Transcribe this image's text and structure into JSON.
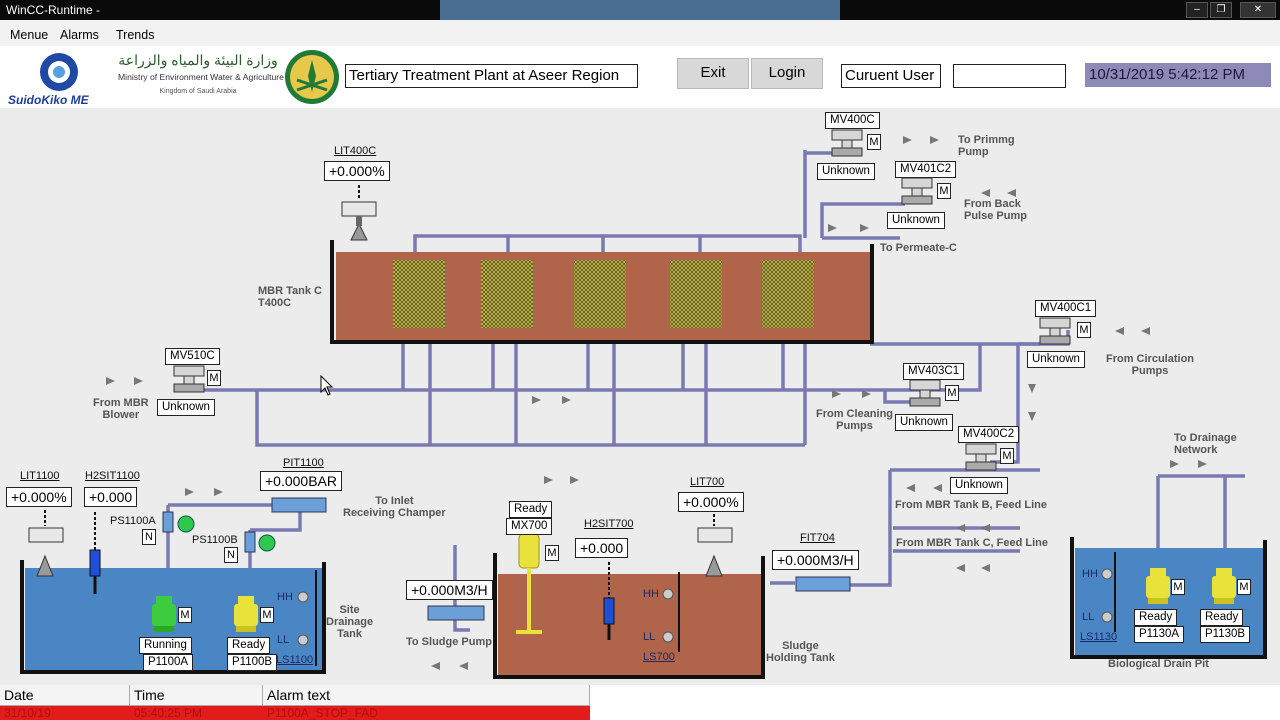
{
  "window": {
    "title": "WinCC-Runtime -"
  },
  "menu": {
    "items": [
      "Menue",
      "Alarms",
      "Trends"
    ]
  },
  "header": {
    "logo_left_text": "SuidoKiko ME",
    "ministry_arabic": "وزارة البيئة والمياه والزراعة",
    "ministry_english": "Ministry of Environment Water & Agriculture",
    "kingdom_line": "Kingdom of Saudi Arabia",
    "plant_title": "Tertiary Treatment Plant at Aseer Region",
    "exit_label": "Exit",
    "login_label": "Login",
    "current_user_label": "Curuent User",
    "current_user_value": "",
    "datetime": "10/31/2019 5:42:12 PM"
  },
  "process": {
    "lit400c": {
      "tag": "LIT400C",
      "value": "+0.000%"
    },
    "mbr_tank": {
      "line1": "MBR Tank C",
      "line2": "T400C"
    },
    "mv400c": {
      "tag": "MV400C",
      "mode": "M",
      "status": "Unknown"
    },
    "mv401c2": {
      "tag": "MV401C2",
      "mode": "M",
      "status": "Unknown"
    },
    "mv400c1": {
      "tag": "MV400C1",
      "mode": "M",
      "status": "Unknown"
    },
    "mv403c1": {
      "tag": "MV403C1",
      "mode": "M",
      "status": "Unknown"
    },
    "mv400c2": {
      "tag": "MV400C2",
      "mode": "M",
      "status": "Unknown"
    },
    "mv510c": {
      "tag": "MV510C",
      "mode": "M",
      "status": "Unknown"
    },
    "lbl_priming": {
      "line1": "To Primmg",
      "line2": "Pump"
    },
    "lbl_backpulse": {
      "line1": "From Back",
      "line2": "Pulse Pump"
    },
    "lbl_permeate": "To Permeate-C",
    "lbl_circulation": {
      "line1": "From Circulation",
      "line2": "Pumps"
    },
    "lbl_cleaning": {
      "line1": "From Cleaning",
      "line2": "Pumps"
    },
    "lbl_mbr_blower": {
      "line1": "From MBR",
      "line2": "Blower"
    },
    "lbl_feed_b": "From MBR Tank B, Feed Line",
    "lbl_feed_c": "From MBR Tank C, Feed Line",
    "lbl_drainage_network": {
      "line1": "To Drainage",
      "line2": "Network"
    },
    "lit1100": {
      "tag": "LIT1100",
      "value": "+0.000%"
    },
    "h2sit1100": {
      "tag": "H2SIT1100",
      "value": "+0.000"
    },
    "pit1100": {
      "tag": "PIT1100",
      "value": "+0.000BAR"
    },
    "lbl_inlet": {
      "line1": "To Inlet",
      "line2": "Receiving Champer"
    },
    "ps1100a": {
      "tag": "PS1100A",
      "mode": "N"
    },
    "ps1100b": {
      "tag": "PS1100B",
      "mode": "N"
    },
    "p1100a": {
      "tag": "P1100A",
      "status": "Running",
      "mode": "M"
    },
    "p1100b": {
      "tag": "P1100B",
      "status": "Ready",
      "mode": "M"
    },
    "site_tank": {
      "line1": "Site",
      "line2": "Drainage",
      "line3": "Tank",
      "hh": "HH",
      "ll": "LL",
      "ls": "LS1100"
    },
    "mx700": {
      "tag": "MX700",
      "status": "Ready",
      "mode": "M"
    },
    "h2sit700": {
      "tag": "H2SIT700",
      "value": "+0.000"
    },
    "lit700": {
      "tag": "LIT700",
      "value": "+0.000%"
    },
    "sludge_flow": {
      "value": "+0.000M3/H"
    },
    "lbl_sludge_pump": "To Sludge Pump",
    "sludge_tank": {
      "line1": "Sludge",
      "line2": "Holding Tank",
      "hh": "HH",
      "ll": "LL",
      "ls": "LS700"
    },
    "fit704": {
      "tag": "FIT704",
      "value": "+0.000M3/H"
    },
    "bio_pit": {
      "label": "Biological Drain Pit",
      "hh": "HH",
      "ll": "LL",
      "ls": "LS1130"
    },
    "p1130a": {
      "tag": "P1130A",
      "status": "Ready",
      "mode": "M"
    },
    "p1130b": {
      "tag": "P1130B",
      "status": "Ready",
      "mode": "M"
    }
  },
  "alarms": {
    "headers": [
      "Date",
      "Time",
      "Alarm text"
    ],
    "rows": [
      {
        "date": "31/10/19",
        "time": "05:40:25 PM",
        "text": "P1100A_STOP_FAD"
      }
    ]
  },
  "colors": {
    "pipe": "#7b79b2",
    "tank_brown": "#b0654a",
    "tank_blue": "#4b86c4",
    "pump_yellow": "#e8e23a",
    "pump_green": "#3dcc3d",
    "alarm_red": "#e21b1b"
  }
}
